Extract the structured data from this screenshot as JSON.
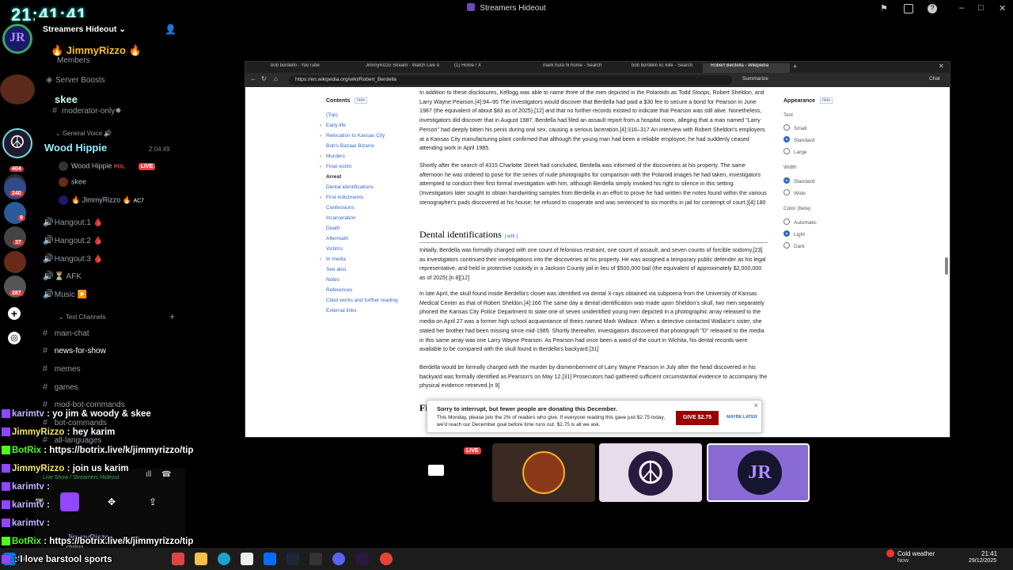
{
  "window": {
    "title": "Streamers Hideout"
  },
  "overlay": {
    "clock": "21:41:41"
  },
  "server": {
    "name": "Streamers Hideout",
    "server_boosts": "Server Boosts",
    "members": "Members"
  },
  "rail_badges": [
    "404",
    "240",
    "9",
    "37",
    "287"
  ],
  "channels": {
    "jimmy_top": "🔥 JimmyRizzo 🔥",
    "skee_top": "skee",
    "moderator": "moderator-only✸",
    "general_voice_cat": "General Voice 🔊",
    "wood_hippie_banner": "Wood Hippie",
    "voice_timer": "2:04:49",
    "voice_users": [
      {
        "name": "Wood Hippie",
        "tag": "POL",
        "live": "LIVE"
      },
      {
        "name": "skee"
      },
      {
        "name": "🔥 JimmyRizzo 🔥",
        "tag": "AC7"
      }
    ],
    "voice_channels": [
      "Hangout:1 🩸",
      "Hangout:2 🩸",
      "Hangout:3 🩸",
      "AFK",
      "Music ▶️"
    ],
    "text_cat": "Text Channels",
    "text_channels": [
      "main-chat",
      "news-for-show",
      "memes",
      "games",
      "mod-bot-commands",
      "bot-commands",
      "all-languages"
    ]
  },
  "user_panel": {
    "name": "JimmyRizzo",
    "status": "Live Show",
    "server": "Streamers Hideout",
    "chilling": "chilling"
  },
  "overlay_chat": [
    {
      "user": "karimtv",
      "msg": "yo jim & woody & skee"
    },
    {
      "user": "JimmyRizzo",
      "msg": "hey karim"
    },
    {
      "user": "BotRix",
      "msg": "https://botrix.live/k/jimmyrizzo/tip"
    },
    {
      "user": "JimmyRizzo",
      "msg": "join us karim"
    },
    {
      "user": "karimtv",
      "msg": ""
    },
    {
      "user": "karimtv",
      "msg": ""
    },
    {
      "user": "karimtv",
      "msg": ""
    },
    {
      "user": "BotRix",
      "msg": "https://botrix.live/k/jimmyrizzo/tip"
    },
    {
      "user": "",
      "msg": "I love barstool sports"
    }
  ],
  "browser": {
    "tabs": [
      "bob bordello - YouTube",
      "JimmyRizzo Stream - Watch Live o",
      "(1) Home / X",
      "mark hura hi home - Search",
      "bob bordello kc kille - Search",
      "Robert Berdella - Wikipedia"
    ],
    "url": "https://en.wikipedia.org/wiki/Robert_Berdella",
    "summarize": "Summarize",
    "chat": "Chat"
  },
  "wiki": {
    "contents_title": "Contents",
    "hide": "hide",
    "toc": [
      "(Top)",
      "Early life",
      "Relocation to Kansas City",
      "Bob's Bazaar Bizarre",
      "Murders",
      "Final victim",
      "Arrest",
      "Dental identifications",
      "First indictments",
      "Confessions",
      "Incarceration",
      "Death",
      "Aftermath",
      "Victims",
      "In media",
      "See also",
      "Notes",
      "References",
      "Cited works and further reading",
      "External links"
    ],
    "p1": "In addition to these disclosures, Kellogg was able to name three of the men depicted in the Polaroids as Todd Stoops, Robert Sheldon, and Larry Wayne Pearson.[4]:94–95 The investigators would discover that Berdella had paid a $30 fee to secure a bond for Pearson in June 1987 (the equivalent of about $83 as of 2025),[12] and that no further records existed to indicate that Pearson was still alive. Nonetheless, investigators did discover that in August 1987, Berdella had filed an assault report from a hospital room, alleging that a man named \"Larry Person\" had deeply bitten his penis during oral sex, causing a serious laceration.[4]:316–317 An interview with Robert Sheldon's employers at a Kansas City manufacturing plant confirmed that although the young man had been a reliable employee, he had suddenly ceased attending work in April 1985.",
    "p2": "Shortly after the search of 4315 Charlotte Street had concluded, Berdella was informed of the discoveries at his property. The same afternoon he was ordered to pose for the series of nude photographs for comparison with the Polaroid images he had taken, investigators attempted to conduct their first formal investigation with him, although Berdella simply invoked his right to silence in this setting. (Investigators later sought to obtain handwriting samples from Berdella in an effort to prove he had written the notes found within the various stenographer's pads discovered at his house; he refused to cooperate and was sentenced to six months in jail for contempt of court.)[4]:180",
    "h2": "Dental identifications",
    "edit": "[ edit ]",
    "p3": "Initially, Berdella was formally charged with one count of felonious restraint, one count of assault, and seven counts of forcible sodomy,[23] as investigators continued their investigations into the discoveries at his property. He was assigned a temporary public defender as his legal representative, and held in protective custody in a Jackson County jail in lieu of $500,000 bail (the equivalent of approximately $2,000,000 as of 2025).[n 8][12]",
    "p4": "In late April, the skull found inside Berdella's closet was identified via dental X-rays obtained via subpoena from the University of Kansas Medical Center as that of Robert Sheldon.[4]:166 The same day a dental identification was made upon Sheldon's skull, two men separately phoned the Kansas City Police Department to state one of seven unidentified young men depicted in a photographic array released to the media on April 27 was a former high school acquaintance of theirs named Mark Wallace. When a detective contacted Wallace's sister, she stated her brother had been missing since mid-1985. Shortly thereafter, investigators discovered that photograph \"D\" released to the media in this same array was one Larry Wayne Pearson. As Pearson had once been a ward of the court in Wichita, his dental records were available to be compared with the skull found in Berdella's backyard.[31]",
    "p5": "Berdella would be formally charged with the murder by dismemberment of Larry Wayne Pearson in July after the head discovered in his backyard was formally identified as Pearson's on May 12.[31] Prosecutors had gathered sufficient circumstantial evidence to accompany the physical evidence retrieved.[n 9]",
    "fi": "Fi",
    "appearance": "Appearance",
    "text": "Text",
    "small": "Small",
    "standard": "Standard",
    "large": "Large",
    "width": "Width",
    "wstandard": "Standard",
    "wide": "Wide",
    "color": "Color (beta)",
    "automatic": "Automatic",
    "light": "Light",
    "dark": "Dark",
    "donate_title": "Sorry to interrupt, but fewer people are donating this December.",
    "donate_body": "This Monday, please join the 2% of readers who give. If everyone reading this gave just $2.75 today, we'd reach our December goal before time runs out. $2.75 is all we ask.",
    "give": "GIVE $2.75",
    "later": "MAYBE LATER"
  },
  "stream": {
    "live": "LIVE"
  },
  "taskbar": {
    "weather_title": "Cold weather",
    "weather_sub": "Now",
    "time": "21:41",
    "date": "29/12/2025",
    "start": "Start"
  },
  "colors": {
    "accent": "#5865f2",
    "live": "#ed4245",
    "kick": "#53fc18",
    "wiki_link": "#3366cc",
    "give": "#990000"
  }
}
